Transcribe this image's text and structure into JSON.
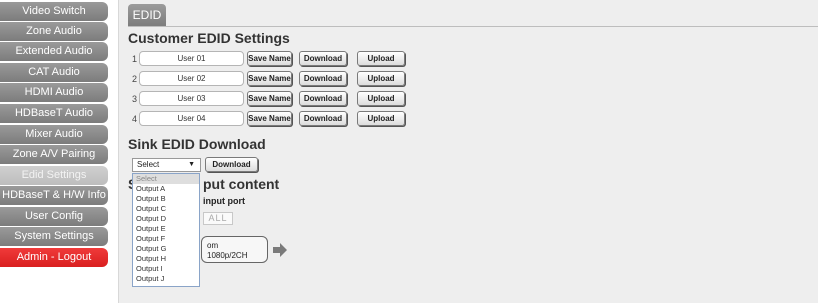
{
  "sidebar": {
    "items": [
      {
        "label": "Video Switch"
      },
      {
        "label": "Zone Audio"
      },
      {
        "label": "Extended Audio"
      },
      {
        "label": "CAT Audio"
      },
      {
        "label": "HDMI Audio"
      },
      {
        "label": "HDBaseT Audio"
      },
      {
        "label": "Mixer Audio"
      },
      {
        "label": "Zone A/V Pairing"
      },
      {
        "label": "Edid Settings"
      },
      {
        "label": "HDBaseT & H/W Info"
      },
      {
        "label": "User Config"
      },
      {
        "label": "System Settings"
      },
      {
        "label": "Admin - Logout"
      }
    ]
  },
  "main": {
    "tab_label": "EDID",
    "customer": {
      "title": "Customer EDID Settings",
      "save_label": "Save Name",
      "download_label": "Download",
      "upload_label": "Upload",
      "rows": [
        {
          "num": "1",
          "name": "User 01"
        },
        {
          "num": "2",
          "name": "User 02"
        },
        {
          "num": "3",
          "name": "User 03"
        },
        {
          "num": "4",
          "name": "User 04"
        }
      ]
    },
    "sink": {
      "title": "Sink EDID Download",
      "selected": "Select",
      "download_label": "Download",
      "options": [
        "Select",
        "Output A",
        "Output B",
        "Output C",
        "Output D",
        "Output E",
        "Output F",
        "Output G",
        "Output H",
        "Output I",
        "Output J"
      ]
    },
    "input": {
      "title_prefix": "S",
      "title_suffix": "put content",
      "port_label": "input port",
      "all_label": "ALL",
      "src_line1": "om",
      "src_line2": "1080p/2CH"
    }
  }
}
